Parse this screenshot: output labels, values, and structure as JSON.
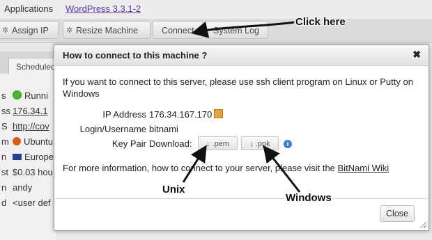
{
  "header": {
    "apps_label": "Applications",
    "app_link": "WordPress 3.3.1-2"
  },
  "toolbar": {
    "buttons": [
      {
        "label": "Assign IP",
        "icon": "gear-icon"
      },
      {
        "label": "Resize Machine",
        "icon": "gear-icon"
      },
      {
        "label": "Connect"
      },
      {
        "label": "System Log"
      }
    ]
  },
  "left_panel": {
    "tab": "Scheduled",
    "rows": [
      {
        "key": "s",
        "value": "Runni",
        "icon": "status-running-icon"
      },
      {
        "key": "ss",
        "value": "176.34.1"
      },
      {
        "key": "S",
        "value": "http://cov"
      },
      {
        "key": "m",
        "value": "Ubuntu",
        "icon": "ubuntu-icon"
      },
      {
        "key": "n",
        "value": "Europe",
        "icon": "eu-flag-icon"
      },
      {
        "key": "st",
        "value": "$0.03 hou"
      },
      {
        "key": "n",
        "value": "andy"
      },
      {
        "key": "d",
        "value": "<user def"
      }
    ]
  },
  "modal": {
    "title": "How to connect to this machine ?",
    "close_symbol": "✖",
    "intro": "If you want to connect to this server, please use ssh client program on Linux or Putty on Windows",
    "fields": {
      "ip_label": "IP Address",
      "ip_value": "176.34.167.170",
      "login_label": "Login/Username",
      "login_value": "bitnami",
      "keypair_label": "Key Pair",
      "download_label": "Download:"
    },
    "download_buttons": [
      {
        "label": ".pem",
        "arrow": "↓"
      },
      {
        "label": ".ppk",
        "arrow": "↓"
      }
    ],
    "info_symbol": "i",
    "more_info_prefix": "For more information, how to connect to your server, please visit the ",
    "more_info_link": "BitNami Wiki",
    "close_button": "Close"
  },
  "annotations": {
    "click_here": "Click here",
    "unix": "Unix",
    "windows": "Windows"
  }
}
